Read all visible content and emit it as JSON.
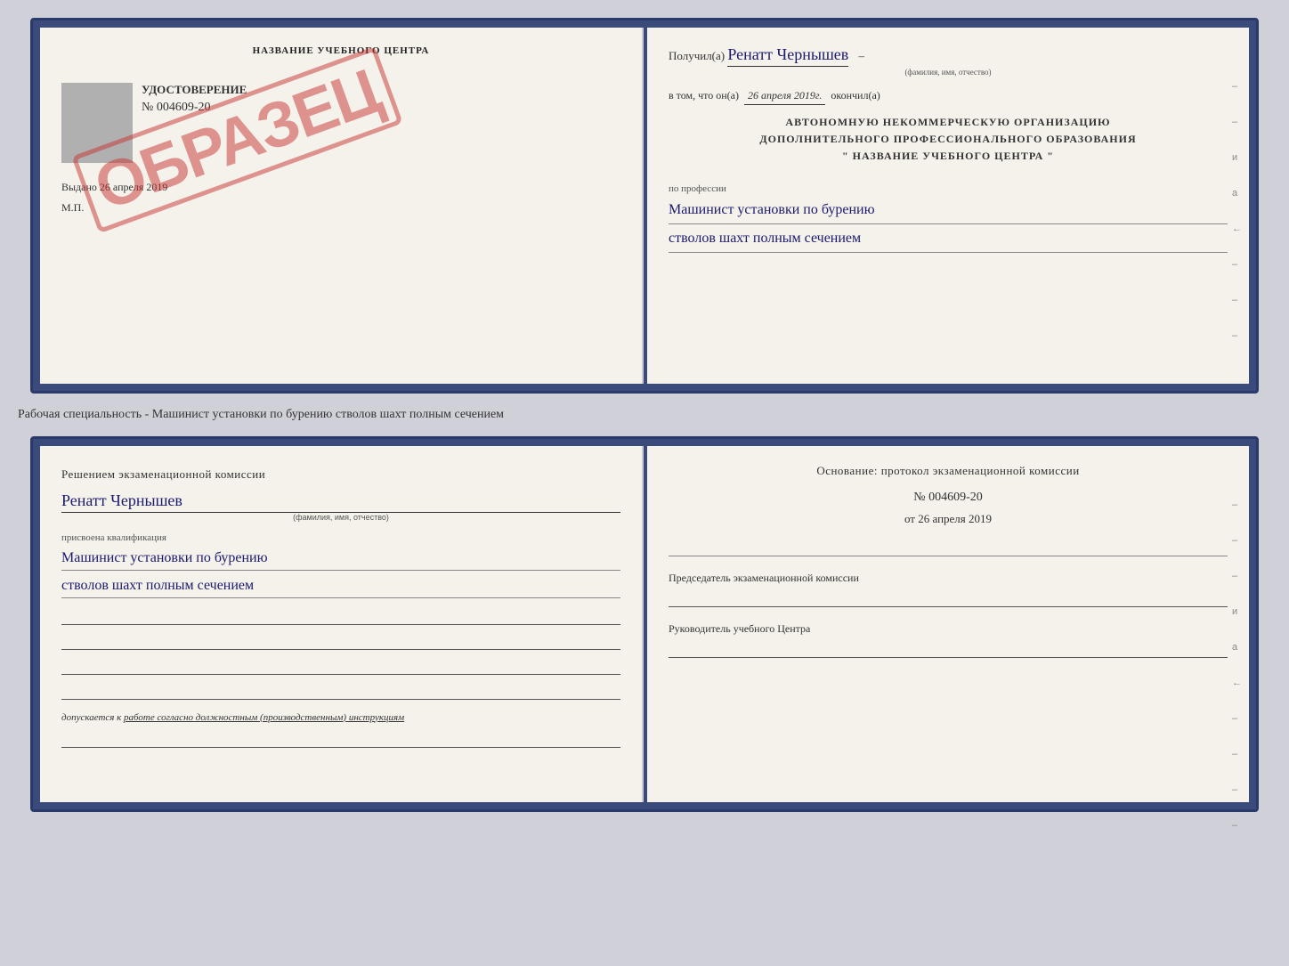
{
  "top_document": {
    "left": {
      "title": "НАЗВАНИЕ УЧЕБНОГО ЦЕНТРА",
      "stamp": "ОБРАЗЕЦ",
      "udostoverenie_label": "УДОСТОВЕРЕНИЕ",
      "number": "№ 004609-20",
      "vydano_label": "Выдано",
      "vydano_date": "26 апреля 2019",
      "mp_label": "М.П."
    },
    "right": {
      "received_prefix": "Получил(а)",
      "recipient_name": "Ренатт Чернышев",
      "name_sublabel": "(фамилия, имя, отчество)",
      "dash1": "–",
      "in_that_prefix": "в том, что он(а)",
      "completed_date": "26 апреля 2019г.",
      "completed_suffix": "окончил(а)",
      "org_line1": "АВТОНОМНУЮ НЕКОММЕРЧЕСКУЮ ОРГАНИЗАЦИЮ",
      "org_line2": "ДОПОЛНИТЕЛЬНОГО ПРОФЕССИОНАЛЬНОГО ОБРАЗОВАНИЯ",
      "org_line3": "\"  НАЗВАНИЕ УЧЕБНОГО ЦЕНТРА  \"",
      "i_label": "и",
      "a_label": "а",
      "left_arrow": "←",
      "profession_prefix": "по профессии",
      "profession_handwritten1": "Машинист установки по бурению",
      "profession_handwritten2": "стволов шахт полным сечением"
    }
  },
  "between_label": "Рабочая специальность - Машинист установки по бурению стволов шахт полным сечением",
  "bottom_document": {
    "left": {
      "decision_text": "Решением  экзаменационной  комиссии",
      "person_name": "Ренатт Чернышев",
      "name_sublabel": "(фамилия, имя, отчество)",
      "assigned_label": "присвоена квалификация",
      "qualification1": "Машинист установки по бурению",
      "qualification2": "стволов шахт полным сечением",
      "admitted_prefix": "допускается к",
      "admitted_text": "работе согласно должностным (производственным) инструкциям"
    },
    "right": {
      "osnov_label": "Основание: протокол экзаменационной  комиссии",
      "protocol_number": "№  004609-20",
      "protocol_date_prefix": "от",
      "protocol_date": "26 апреля 2019",
      "chairman_label": "Председатель экзаменационной комиссии",
      "director_label": "Руководитель учебного Центра",
      "i_label": "и",
      "a_label": "а",
      "left_arrow": "←",
      "dash_items": [
        "–",
        "–",
        "–",
        "–",
        "–"
      ]
    }
  }
}
